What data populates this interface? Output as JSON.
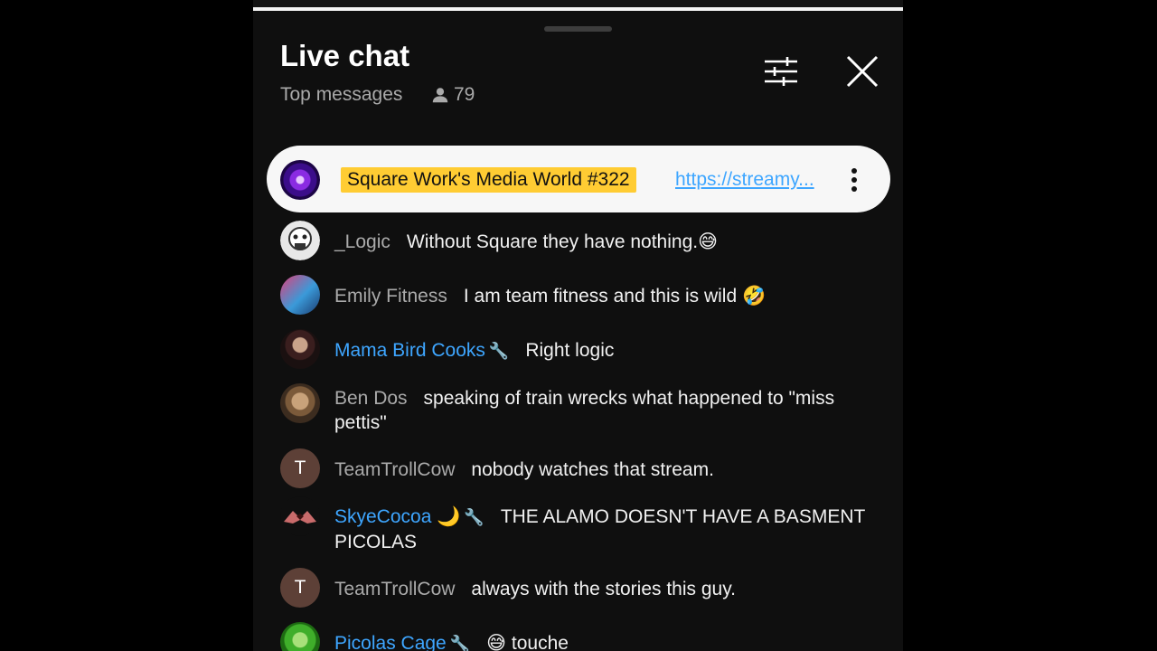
{
  "header": {
    "title": "Live chat",
    "subtitle": "Top messages",
    "viewer_count": "79"
  },
  "pinned": {
    "title": "Square Work's Media World #322",
    "link": "https://streamy..."
  },
  "messages": [
    {
      "author": "_Logic",
      "text": "Without Square they have nothing.",
      "emoji": "😅"
    },
    {
      "author": "Emily Fitness",
      "text": "I am team fitness and this is wild",
      "emoji": "🤣"
    },
    {
      "author": "Mama Bird Cooks",
      "text": "Right logic"
    },
    {
      "author": "Ben Dos",
      "text": "speaking of train wrecks what happened to \"miss pettis\""
    },
    {
      "author": "TeamTrollCow",
      "initial": "T",
      "text": "nobody watches that stream."
    },
    {
      "author": "SkyeCocoa",
      "author_emoji": "🌙",
      "text": "THE ALAMO DOESN'T HAVE A BASMENT PICOLAS"
    },
    {
      "author": "TeamTrollCow",
      "initial": "T",
      "text": "always with the stories this guy."
    },
    {
      "author": "Picolas Cage",
      "emoji": "😅",
      "text": "touche"
    }
  ],
  "colors": {
    "background": "#0f0f0f",
    "moderator": "#3ea6ff",
    "pinned_highlight": "#ffcc33"
  }
}
